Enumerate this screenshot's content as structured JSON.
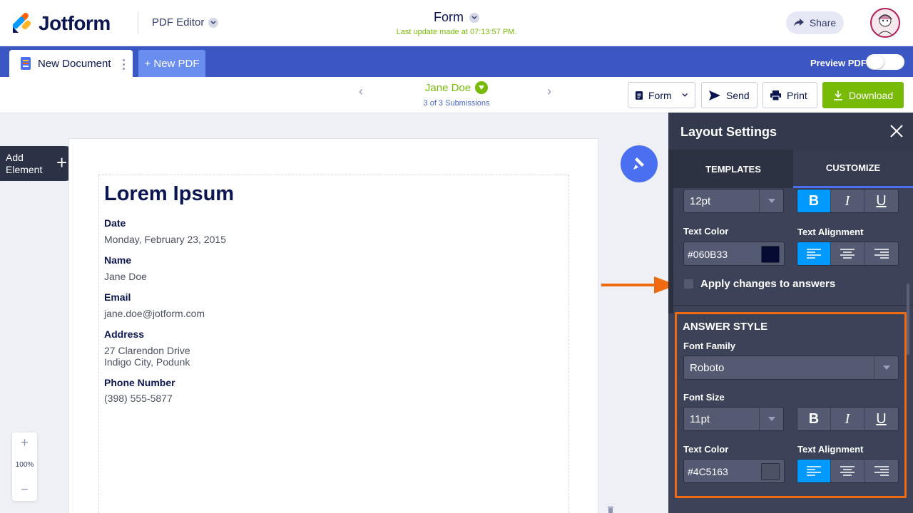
{
  "header": {
    "brand": "Jotform",
    "editor_label": "PDF Editor",
    "form_title": "Form",
    "last_update": "Last update made at 07:13:57 PM.",
    "share_label": "Share"
  },
  "tabs": {
    "document_label": "New Document",
    "new_pdf_label": "+ New PDF",
    "preview_label": "Preview PDF",
    "preview_on": false
  },
  "submission": {
    "name": "Jane Doe",
    "count": "3 of 3 Submissions"
  },
  "toolbar": {
    "form_label": "Form",
    "send_label": "Send",
    "print_label": "Print",
    "download_label": "Download"
  },
  "add_element": {
    "line1": "Add",
    "line2": "Element",
    "plus": "+"
  },
  "zoom": {
    "plus": "+",
    "value": "100%",
    "minus": "−"
  },
  "document": {
    "heading": "Lorem Ipsum",
    "fields": [
      {
        "label": "Date",
        "value": "Monday, February 23, 2015"
      },
      {
        "label": "Name",
        "value": "Jane Doe"
      },
      {
        "label": "Email",
        "value": "jane.doe@jotform.com"
      },
      {
        "label": "Address",
        "value": "27 Clarendon Drive",
        "value2": "Indigo City, Podunk"
      },
      {
        "label": "Phone Number",
        "value": "(398) 555-5877"
      }
    ]
  },
  "panel": {
    "title": "Layout Settings",
    "tabs": [
      "TEMPLATES",
      "CUSTOMIZE"
    ],
    "active_tab": "CUSTOMIZE",
    "question": {
      "font_size": "12pt",
      "text_color_label": "Text Color",
      "text_color": "#060B33",
      "text_align_label": "Text Alignment"
    },
    "apply_changes_label": "Apply changes to answers",
    "answer": {
      "title": "ANSWER STYLE",
      "font_family_label": "Font Family",
      "font_family": "Roboto",
      "font_size_label": "Font Size",
      "font_size": "11pt",
      "text_color_label": "Text Color",
      "text_color": "#4C5163",
      "text_align_label": "Text Alignment"
    },
    "format_buttons": [
      "B",
      "I",
      "U"
    ]
  },
  "colors": {
    "brand_green": "#78bb07",
    "brand_blue": "#3a57c4",
    "highlight_orange": "#f06a11",
    "active_blue": "#0099ff"
  }
}
